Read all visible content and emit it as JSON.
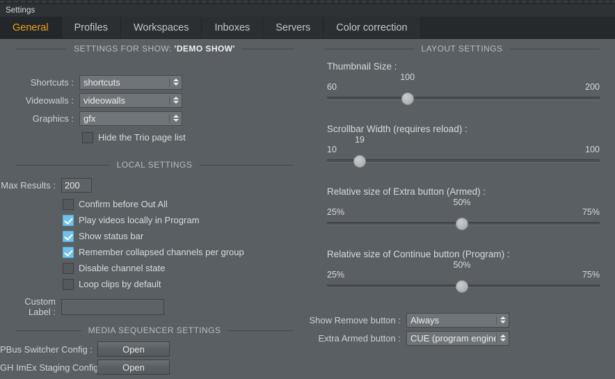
{
  "window": {
    "title": "Settings"
  },
  "tabs": [
    {
      "label": "General",
      "active": true
    },
    {
      "label": "Profiles",
      "active": false
    },
    {
      "label": "Workspaces",
      "active": false
    },
    {
      "label": "Inboxes",
      "active": false
    },
    {
      "label": "Servers",
      "active": false
    },
    {
      "label": "Color correction",
      "active": false
    }
  ],
  "show_settings": {
    "heading_prefix": "SETTINGS FOR SHOW:",
    "heading_show": "'DEMO SHOW'",
    "rows": [
      {
        "label": "Shortcuts :",
        "value": "shortcuts"
      },
      {
        "label": "Videowalls :",
        "value": "videowalls"
      },
      {
        "label": "Graphics :",
        "value": "gfx"
      }
    ],
    "hide_trio": {
      "label": "Hide the Trio page list",
      "checked": false
    }
  },
  "local_settings": {
    "heading": "LOCAL SETTINGS",
    "max_results": {
      "label": "Max Results :",
      "value": "200"
    },
    "checkboxes": [
      {
        "label": "Confirm before Out All",
        "checked": false
      },
      {
        "label": "Play videos locally in Program",
        "checked": true
      },
      {
        "label": "Show status bar",
        "checked": true
      },
      {
        "label": "Remember collapsed channels per group",
        "checked": true
      },
      {
        "label": "Disable channel state",
        "checked": false
      },
      {
        "label": "Loop clips by default",
        "checked": false
      }
    ],
    "custom_label": {
      "label_line1": "Custom",
      "label_line2": "Label :",
      "value": ""
    }
  },
  "media_sequencer": {
    "heading": "MEDIA SEQUENCER SETTINGS",
    "rows": [
      {
        "label": "PBus Switcher Config :",
        "button": "Open"
      },
      {
        "label": "GH ImEx Staging Config :",
        "button": "Open"
      }
    ]
  },
  "layout_settings": {
    "heading": "LAYOUT SETTINGS",
    "sliders": [
      {
        "title": "Thumbnail Size :",
        "current": "100",
        "min_label": "60",
        "max_label": "200",
        "min": 60,
        "max": 200,
        "value": 100
      },
      {
        "title": "Scrollbar Width (requires reload) :",
        "current": "19",
        "min_label": "10",
        "max_label": "100",
        "min": 10,
        "max": 100,
        "value": 19
      },
      {
        "title": "Relative size of Extra button (Armed) :",
        "current": "50%",
        "min_label": "25%",
        "max_label": "75%",
        "min": 25,
        "max": 75,
        "value": 50
      },
      {
        "title": "Relative size of Continue button (Program) :",
        "current": "50%",
        "min_label": "25%",
        "max_label": "75%",
        "min": 25,
        "max": 75,
        "value": 50
      }
    ],
    "dropdowns": [
      {
        "label": "Show Remove button :",
        "value": "Always"
      },
      {
        "label": "Extra Armed button :",
        "value": "CUE (program engine)"
      }
    ]
  },
  "colors": {
    "panel_bg": "#5a5f63",
    "tabbar_bg": "#26292c",
    "active_tab_text": "#f0a01e",
    "checkbox_on": "#6ec3ea",
    "combo_bg": "#6f7478"
  }
}
